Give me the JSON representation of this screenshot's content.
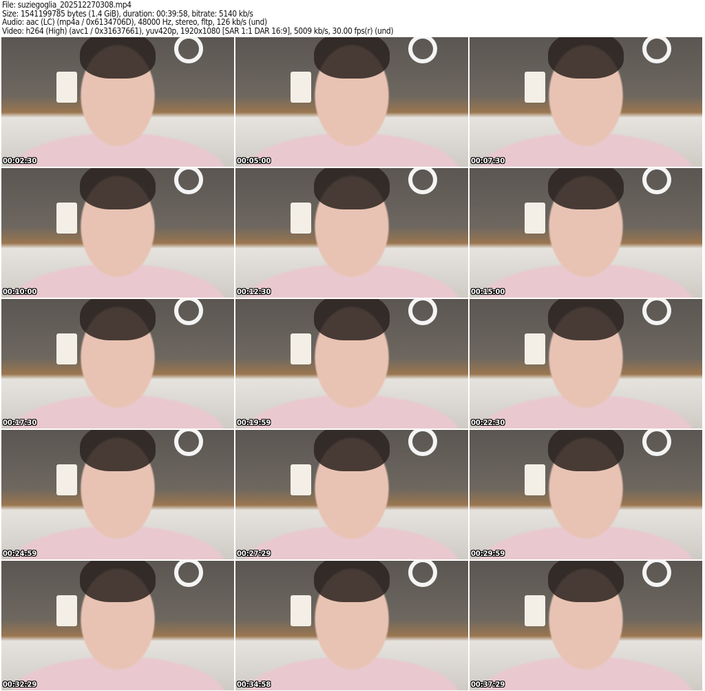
{
  "header": {
    "file": "File: suziegoglia_202512270308.mp4",
    "size": "Size: 1541199785 bytes (1.4 GiB), duration: 00:39:58, bitrate: 5140 kb/s",
    "audio": "Audio: aac (LC) (mp4a / 0x6134706D), 48000 Hz, stereo, fltp, 126 kb/s (und)",
    "video": "Video: h264 (High) (avc1 / 0x31637661), yuv420p, 1920x1080 [SAR 1:1 DAR 16:9], 5009 kb/s, 30.00 fps(r) (und)"
  },
  "thumbnails": [
    "00:02:30",
    "00:05:00",
    "00:07:30",
    "00:10:00",
    "00:12:30",
    "00:15:00",
    "00:17:30",
    "00:19:59",
    "00:22:30",
    "00:24:59",
    "00:27:29",
    "00:29:59",
    "00:32:29",
    "00:34:58",
    "00:37:29"
  ]
}
